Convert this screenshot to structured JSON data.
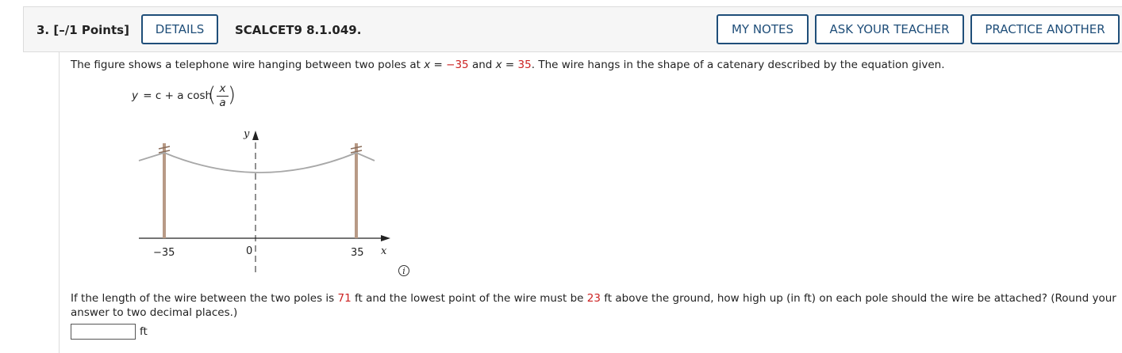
{
  "header": {
    "question_label": "3. [–/1 Points]",
    "details_label": "DETAILS",
    "question_id": "SCALCET9 8.1.049.",
    "my_notes_label": "MY NOTES",
    "ask_teacher_label": "ASK YOUR TEACHER",
    "practice_label": "PRACTICE ANOTHER"
  },
  "intro": {
    "part1": "The figure shows a telephone wire hanging between two poles at ",
    "x_var": "x",
    "eq_sign": " = ",
    "left_val": "−35",
    "and": " and ",
    "x_var2": "x",
    "eq_sign2": " = ",
    "right_val": "35",
    "part2": ". The wire hangs in the shape of a catenary described by the equation given."
  },
  "equation": {
    "lhs": "y",
    "middle": " = c + a cosh",
    "numerator": "x",
    "denominator": "a"
  },
  "figure": {
    "y_label": "y",
    "x_label": "x",
    "tick_left": "−35",
    "tick_origin": "0",
    "tick_right": "35"
  },
  "question": {
    "p1": "If the length of the wire between the two poles is ",
    "length": "71",
    "p2": " ft and the lowest point of the wire must be ",
    "height": "23",
    "p3": " ft above the ground, how high up (in ft) on each pole should the wire be attached? (Round your",
    "p4": "answer to two decimal places.)"
  },
  "answer": {
    "value": "",
    "unit": "ft"
  }
}
